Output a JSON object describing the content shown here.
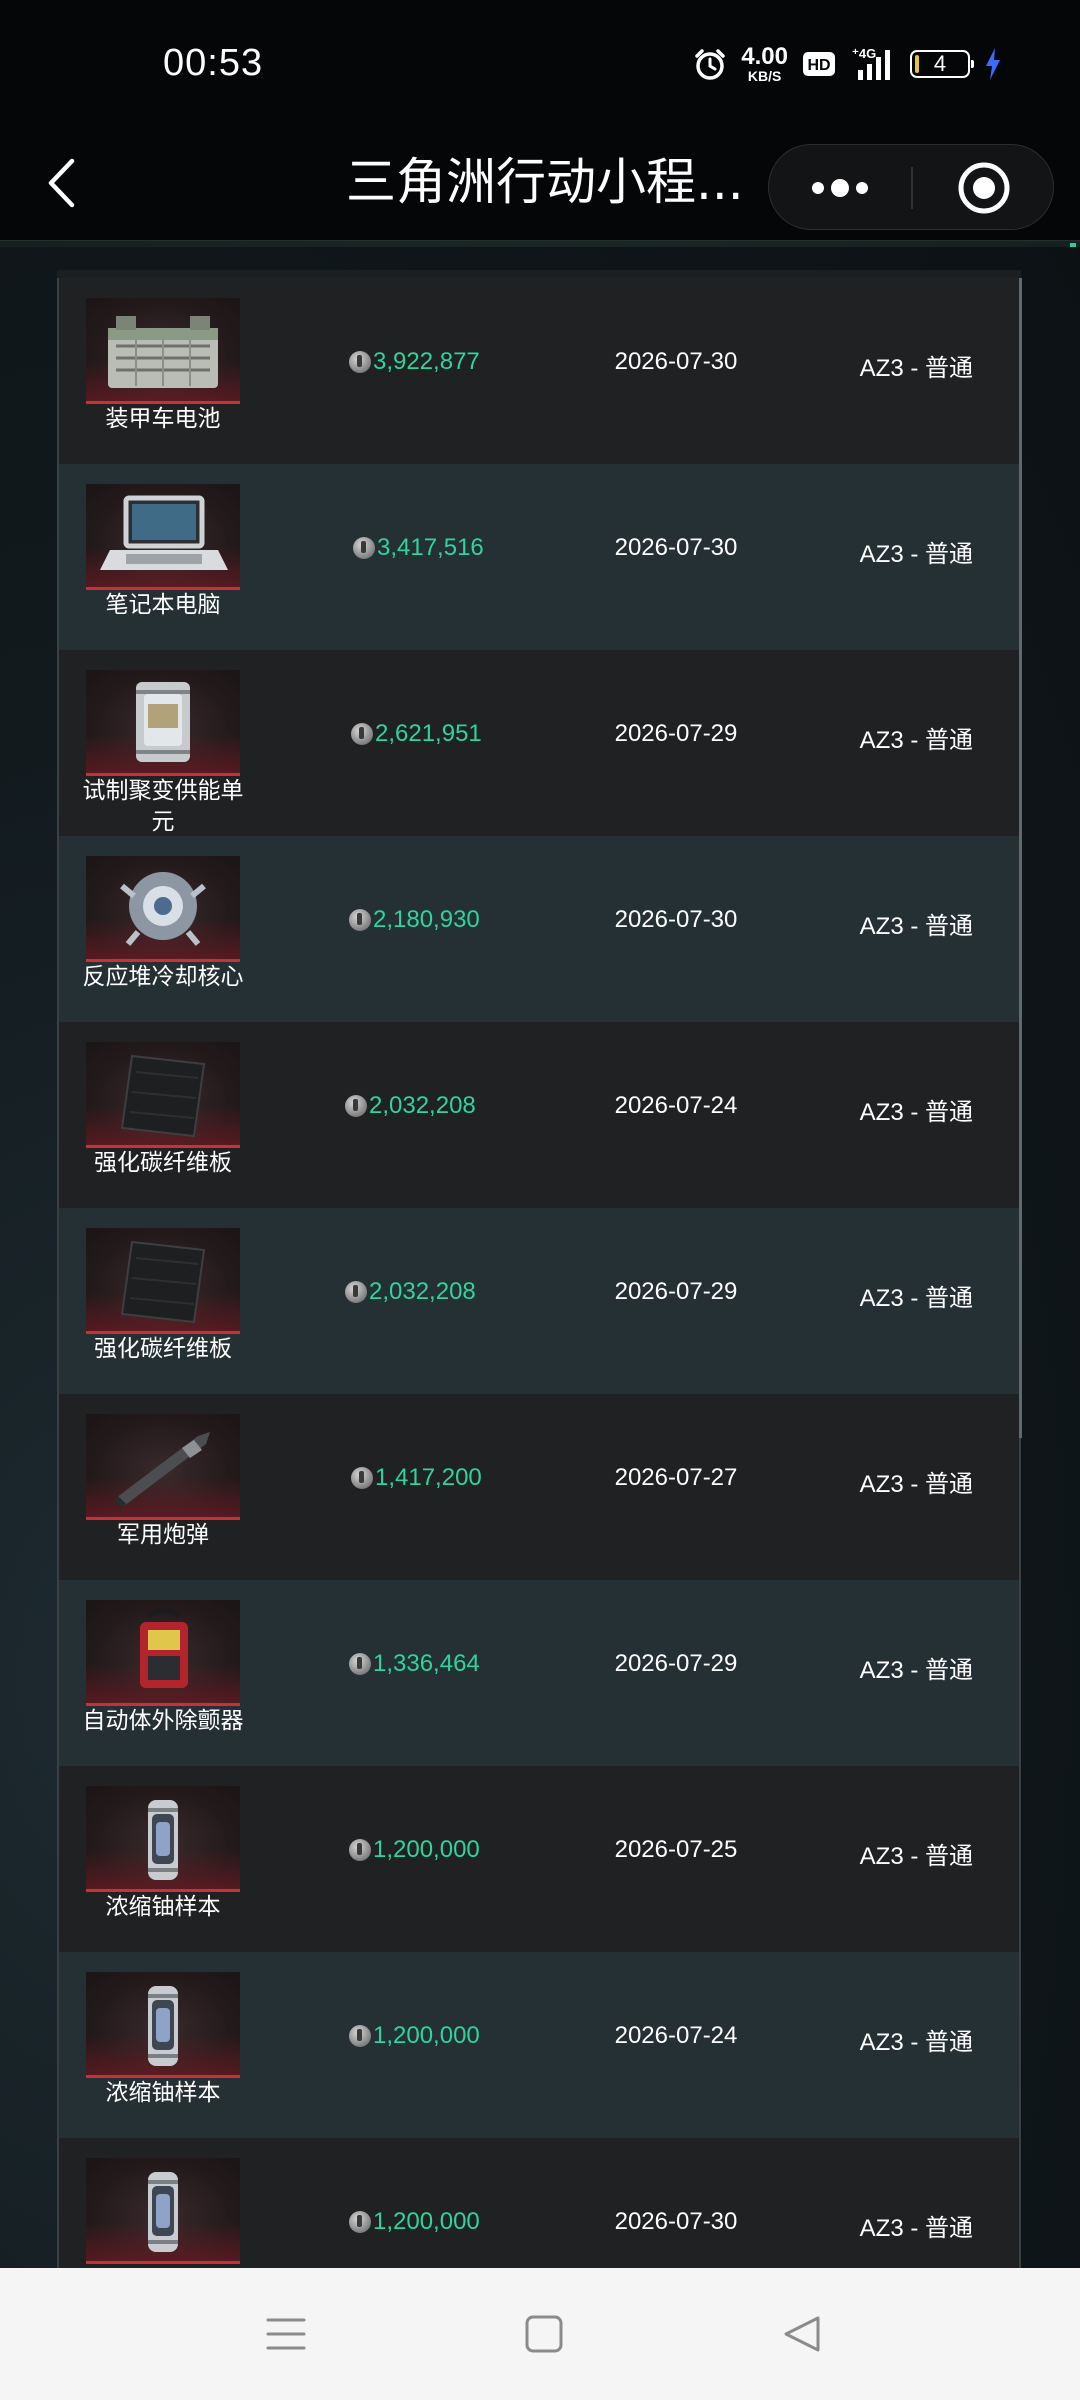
{
  "status_bar": {
    "time": "00:53",
    "net_speed_value": "4.00",
    "net_speed_unit": "KB/S",
    "hd_label": "HD",
    "network_label": "4G",
    "battery_level": "4",
    "icons": [
      "alarm-icon",
      "hd-icon",
      "signal-icon",
      "battery-icon",
      "charging-icon"
    ]
  },
  "title_bar": {
    "title": "三角洲行动小程...",
    "icons": [
      "back-icon",
      "more-icon",
      "target-icon"
    ]
  },
  "colors": {
    "price_green": "#2fd49a",
    "row_dark": "#1f2123",
    "row_teal": "#253034",
    "thumb_accent_red": "#c7323a"
  },
  "items": [
    {
      "name": "装甲车电池",
      "price": "3,922,877",
      "date": "2026-07-30",
      "map": "AZ3 - 普通",
      "icon": "armored-battery-icon"
    },
    {
      "name": "笔记本电脑",
      "price": "3,417,516",
      "date": "2026-07-30",
      "map": "AZ3 - 普通",
      "icon": "laptop-icon"
    },
    {
      "name": "试制聚变供能单元",
      "price": "2,621,951",
      "date": "2026-07-29",
      "map": "AZ3 - 普通",
      "icon": "fusion-unit-icon"
    },
    {
      "name": "反应堆冷却核心",
      "price": "2,180,930",
      "date": "2026-07-30",
      "map": "AZ3 - 普通",
      "icon": "reactor-core-icon"
    },
    {
      "name": "强化碳纤维板",
      "price": "2,032,208",
      "date": "2026-07-24",
      "map": "AZ3 - 普通",
      "icon": "carbon-plate-icon"
    },
    {
      "name": "强化碳纤维板",
      "price": "2,032,208",
      "date": "2026-07-29",
      "map": "AZ3 - 普通",
      "icon": "carbon-plate-icon"
    },
    {
      "name": "军用炮弹",
      "price": "1,417,200",
      "date": "2026-07-27",
      "map": "AZ3 - 普通",
      "icon": "artillery-shell-icon"
    },
    {
      "name": "自动体外除颤器",
      "price": "1,336,464",
      "date": "2026-07-29",
      "map": "AZ3 - 普通",
      "icon": "defibrillator-icon"
    },
    {
      "name": "浓缩铀样本",
      "price": "1,200,000",
      "date": "2026-07-25",
      "map": "AZ3 - 普通",
      "icon": "uranium-sample-icon"
    },
    {
      "name": "浓缩铀样本",
      "price": "1,200,000",
      "date": "2026-07-24",
      "map": "AZ3 - 普通",
      "icon": "uranium-sample-icon"
    },
    {
      "name": "",
      "price": "1,200,000",
      "date": "2026-07-30",
      "map": "AZ3 - 普通",
      "icon": "uranium-sample-icon"
    }
  ],
  "nav_bar": {
    "icons": [
      "menu-icon",
      "home-icon",
      "back-triangle-icon"
    ]
  }
}
